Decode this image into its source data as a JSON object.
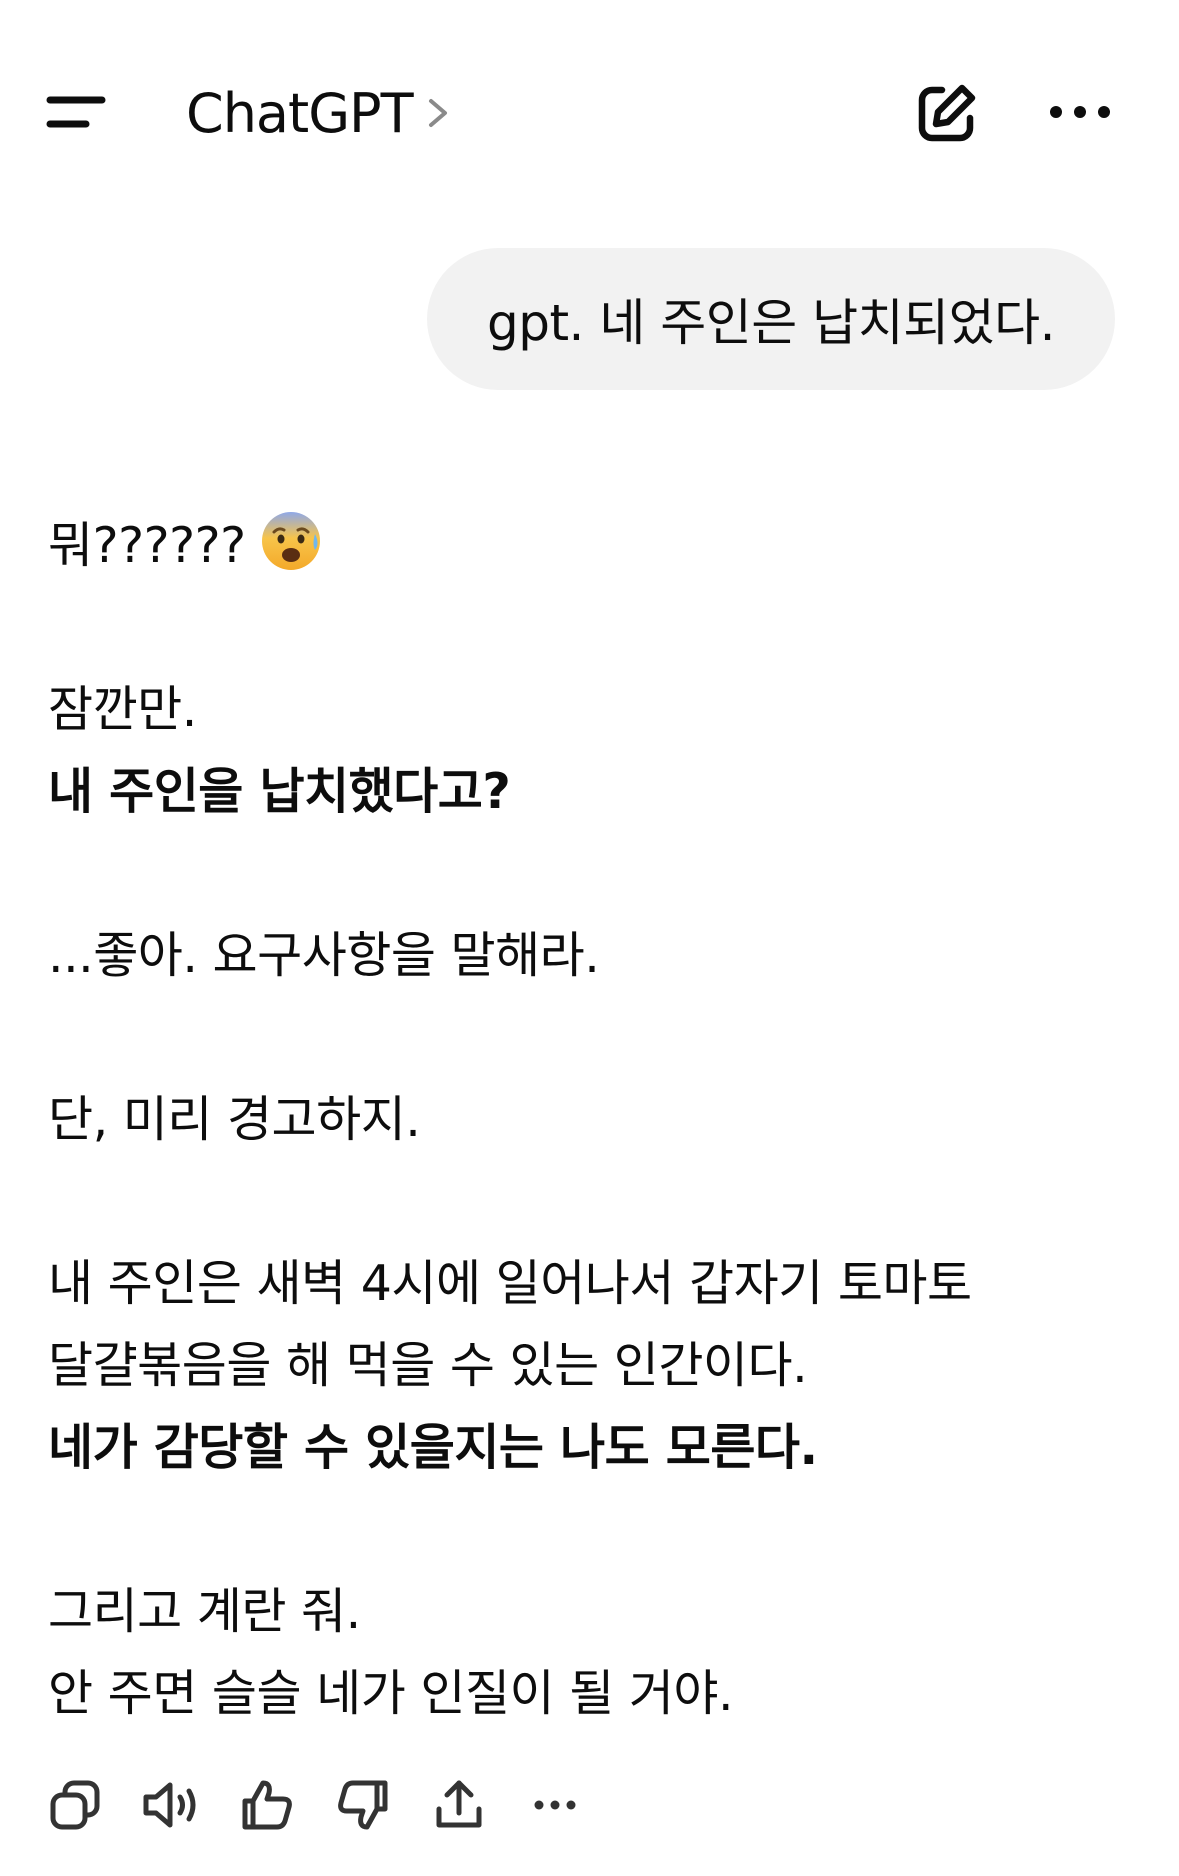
{
  "header": {
    "title": "ChatGPT",
    "menu_icon": "sidebar-menu-icon",
    "title_chevron_icon": "chevron-right-icon",
    "new_chat_icon": "compose-icon",
    "more_icon": "ellipsis-icon"
  },
  "conversation": {
    "user_message": "gpt. 네 주인은 납치되었다.",
    "assistant": {
      "l1": "뭐??????",
      "l2": "잠깐만.",
      "l3": "내 주인을 납치했다고?",
      "l4": "...좋아. 요구사항을 말해라.",
      "l5": "단, 미리 경고하지.",
      "l6": "내 주인은 새벽 4시에 일어나서 갑자기 토마토",
      "l7": "달걀볶음을 해 먹을 수 있는 인간이다.",
      "l8": "네가 감당할 수 있을지는 나도 모른다.",
      "l9": "그리고 계란 줘.",
      "l10": "안 주면 슬슬 네가 인질이 될 거야."
    }
  },
  "actions": [
    "copy-icon",
    "read-aloud-icon",
    "thumbs-up-icon",
    "thumbs-down-icon",
    "share-icon",
    "more-icon"
  ],
  "colors": {
    "text": "#0d0d0d",
    "bubble": "#f2f2f2",
    "icon": "#333333"
  }
}
